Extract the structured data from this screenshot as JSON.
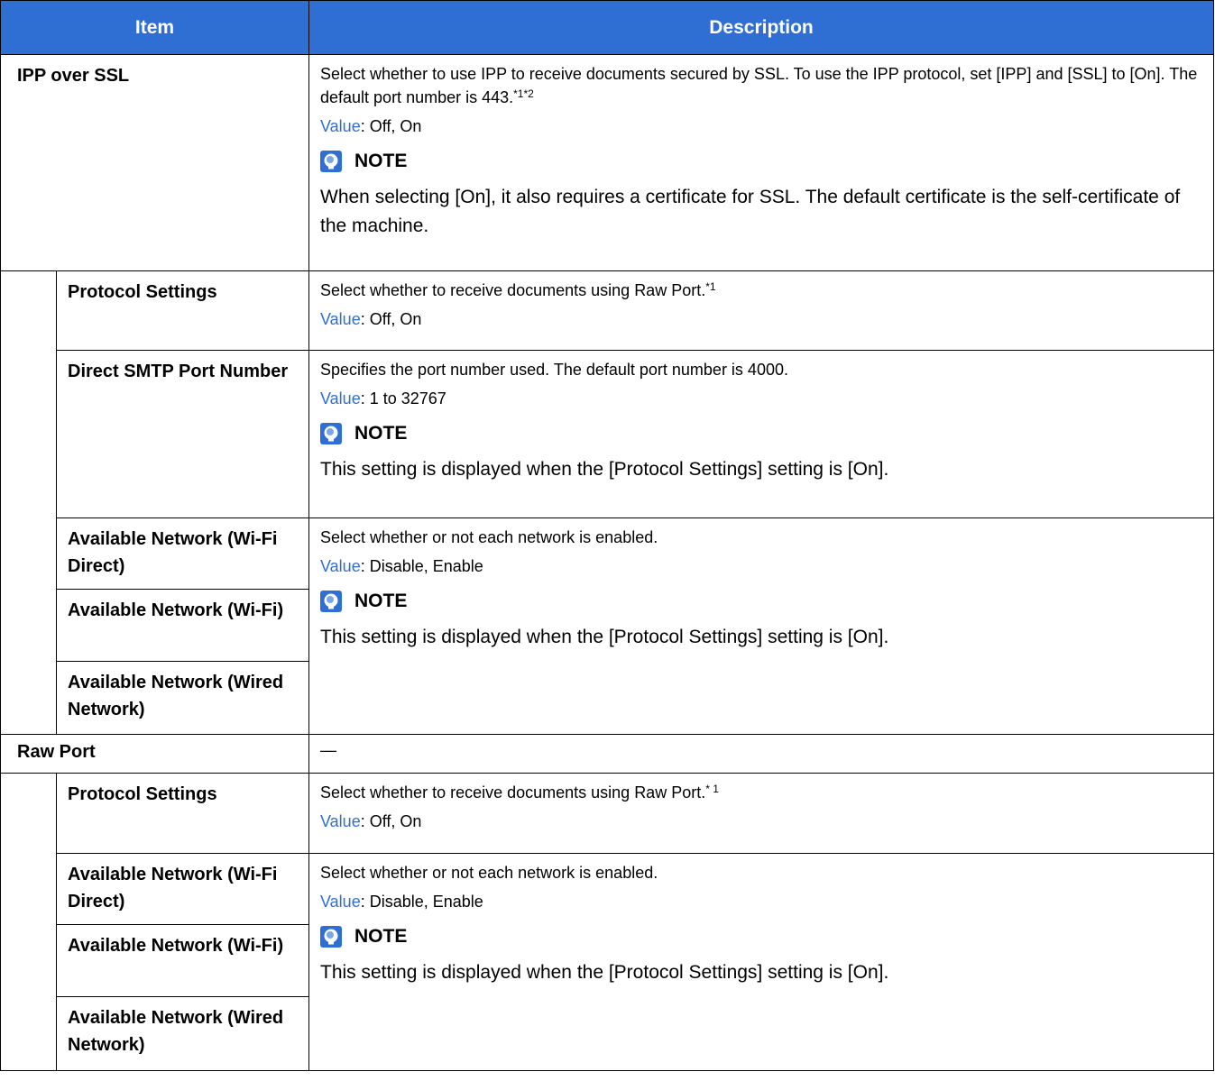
{
  "header": {
    "item": "Item",
    "description": "Description"
  },
  "value_key": "Value",
  "note_label": "NOTE",
  "rows": {
    "ipp_over_ssl": {
      "label": "IPP over SSL",
      "desc": "Select whether to use IPP to receive documents secured by SSL. To use the IPP protocol, set [IPP] and [SSL] to [On]. The default port number is 443.",
      "sup": "*1*2",
      "value": ": Off, On",
      "note": "When selecting [On], it also requires a certificate for SSL. The default certificate is the self-certificate of the machine."
    },
    "protocol_settings": {
      "label": "Protocol Settings",
      "desc": "Select whether to receive documents using Raw Port.",
      "sup": "*1",
      "value": ": Off, On"
    },
    "direct_smtp": {
      "label": "Direct SMTP Port Number",
      "desc": "Specifies the port number used. The default port number is 4000.",
      "value": ": 1 to 32767",
      "note": "This setting is displayed when the [Protocol Settings] setting is [On]."
    },
    "avail_group1": {
      "labels": [
        "Available Network (Wi-Fi Direct)",
        "Available Network (Wi-Fi)",
        "Available Network (Wired Network)"
      ],
      "desc": "Select whether or not each network is enabled.",
      "value": ": Disable, Enable",
      "note": "This setting is displayed when the [Protocol Settings] setting is [On]."
    },
    "raw_port": {
      "label": "Raw Port",
      "desc": "—"
    },
    "raw_protocol_settings": {
      "label": "Protocol Settings",
      "desc": "Select whether to receive documents using Raw Port.",
      "sup": "* 1",
      "value": ": Off, On"
    },
    "avail_group2": {
      "labels": [
        "Available Network (Wi-Fi Direct)",
        "Available Network (Wi-Fi)",
        "Available Network (Wired Network)"
      ],
      "desc": "Select whether or not each network is enabled.",
      "value": ": Disable, Enable",
      "note": "This setting is displayed when the [Protocol Settings] setting is [On]."
    }
  }
}
